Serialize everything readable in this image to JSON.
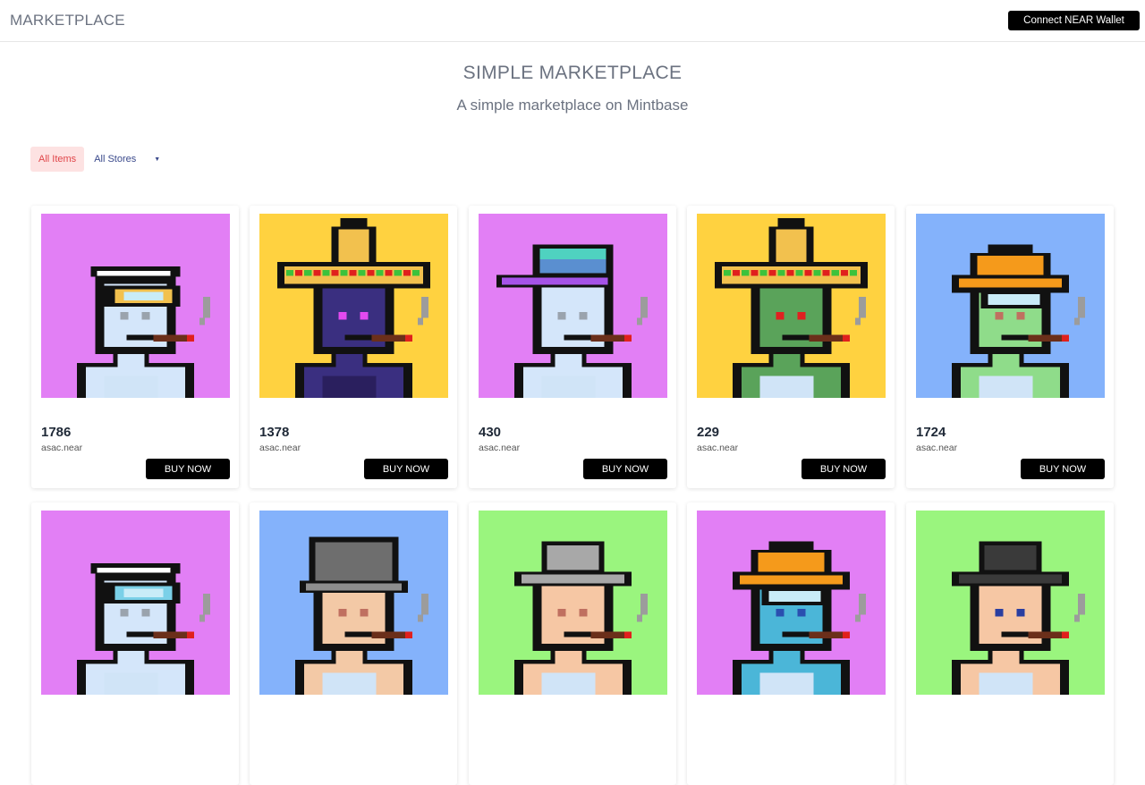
{
  "header": {
    "brand": "MARKETPLACE",
    "connect_label": "Connect NEAR Wallet"
  },
  "hero": {
    "title": "SIMPLE MARKETPLACE",
    "subtitle": "A simple marketplace on Mintbase"
  },
  "filters": {
    "all_items_label": "All Items",
    "stores_label": "All Stores"
  },
  "colors": {
    "pink": "#e27ff5",
    "yellow": "#ffd240",
    "blue": "#84b2fb",
    "green": "#9af57e",
    "buy_button": "#000000",
    "active_tab_bg": "#fde2e2",
    "active_tab_text": "#e0464a"
  },
  "items": [
    {
      "number": "1786",
      "owner": "asac.near",
      "buy_label": "BUY NOW",
      "bg": "#e27ff5",
      "skin": "#d4e6fa",
      "hat": "goggles",
      "hat_color": "#f2c14e",
      "eye": "#9aa3ad"
    },
    {
      "number": "1378",
      "owner": "asac.near",
      "buy_label": "BUY NOW",
      "bg": "#ffd240",
      "skin": "#3a2f80",
      "hat": "sombrero",
      "hat_color": "#f2c14e",
      "eye": "#e34af0"
    },
    {
      "number": "430",
      "owner": "asac.near",
      "buy_label": "BUY NOW",
      "bg": "#e27ff5",
      "skin": "#d4e6fa",
      "hat": "cap",
      "hat_color": "#5a8fd0",
      "eye": "#9aa3ad"
    },
    {
      "number": "229",
      "owner": "asac.near",
      "buy_label": "BUY NOW",
      "bg": "#ffd240",
      "skin": "#5aa35a",
      "hat": "sombrero",
      "hat_color": "#f2c14e",
      "eye": "#e02020"
    },
    {
      "number": "1724",
      "owner": "asac.near",
      "buy_label": "BUY NOW",
      "bg": "#84b2fb",
      "skin": "#8fdc8a",
      "hat": "orange-hat",
      "hat_color": "#f59a1b",
      "eye": "#c07060"
    },
    {
      "number": "",
      "owner": "",
      "buy_label": "",
      "bg": "#e27ff5",
      "skin": "#d4e6fa",
      "hat": "goggles",
      "hat_color": "#7ad0e8",
      "eye": "#9aa3ad"
    },
    {
      "number": "",
      "owner": "",
      "buy_label": "",
      "bg": "#84b2fb",
      "skin": "#f3c9a6",
      "hat": "helmet",
      "hat_color": "#6e6e6e",
      "eye": "#c07060"
    },
    {
      "number": "",
      "owner": "",
      "buy_label": "",
      "bg": "#9af57e",
      "skin": "#f6c7a4",
      "hat": "fedora",
      "hat_color": "#a8a8a8",
      "eye": "#c07060"
    },
    {
      "number": "",
      "owner": "",
      "buy_label": "",
      "bg": "#e27ff5",
      "skin": "#4bb6d8",
      "hat": "orange-hat",
      "hat_color": "#f59a1b",
      "eye": "#2a4fb0"
    },
    {
      "number": "",
      "owner": "",
      "buy_label": "",
      "bg": "#9af57e",
      "skin": "#f6c7a4",
      "hat": "fedora",
      "hat_color": "#3a3a3a",
      "eye": "#2a3ea0"
    }
  ]
}
